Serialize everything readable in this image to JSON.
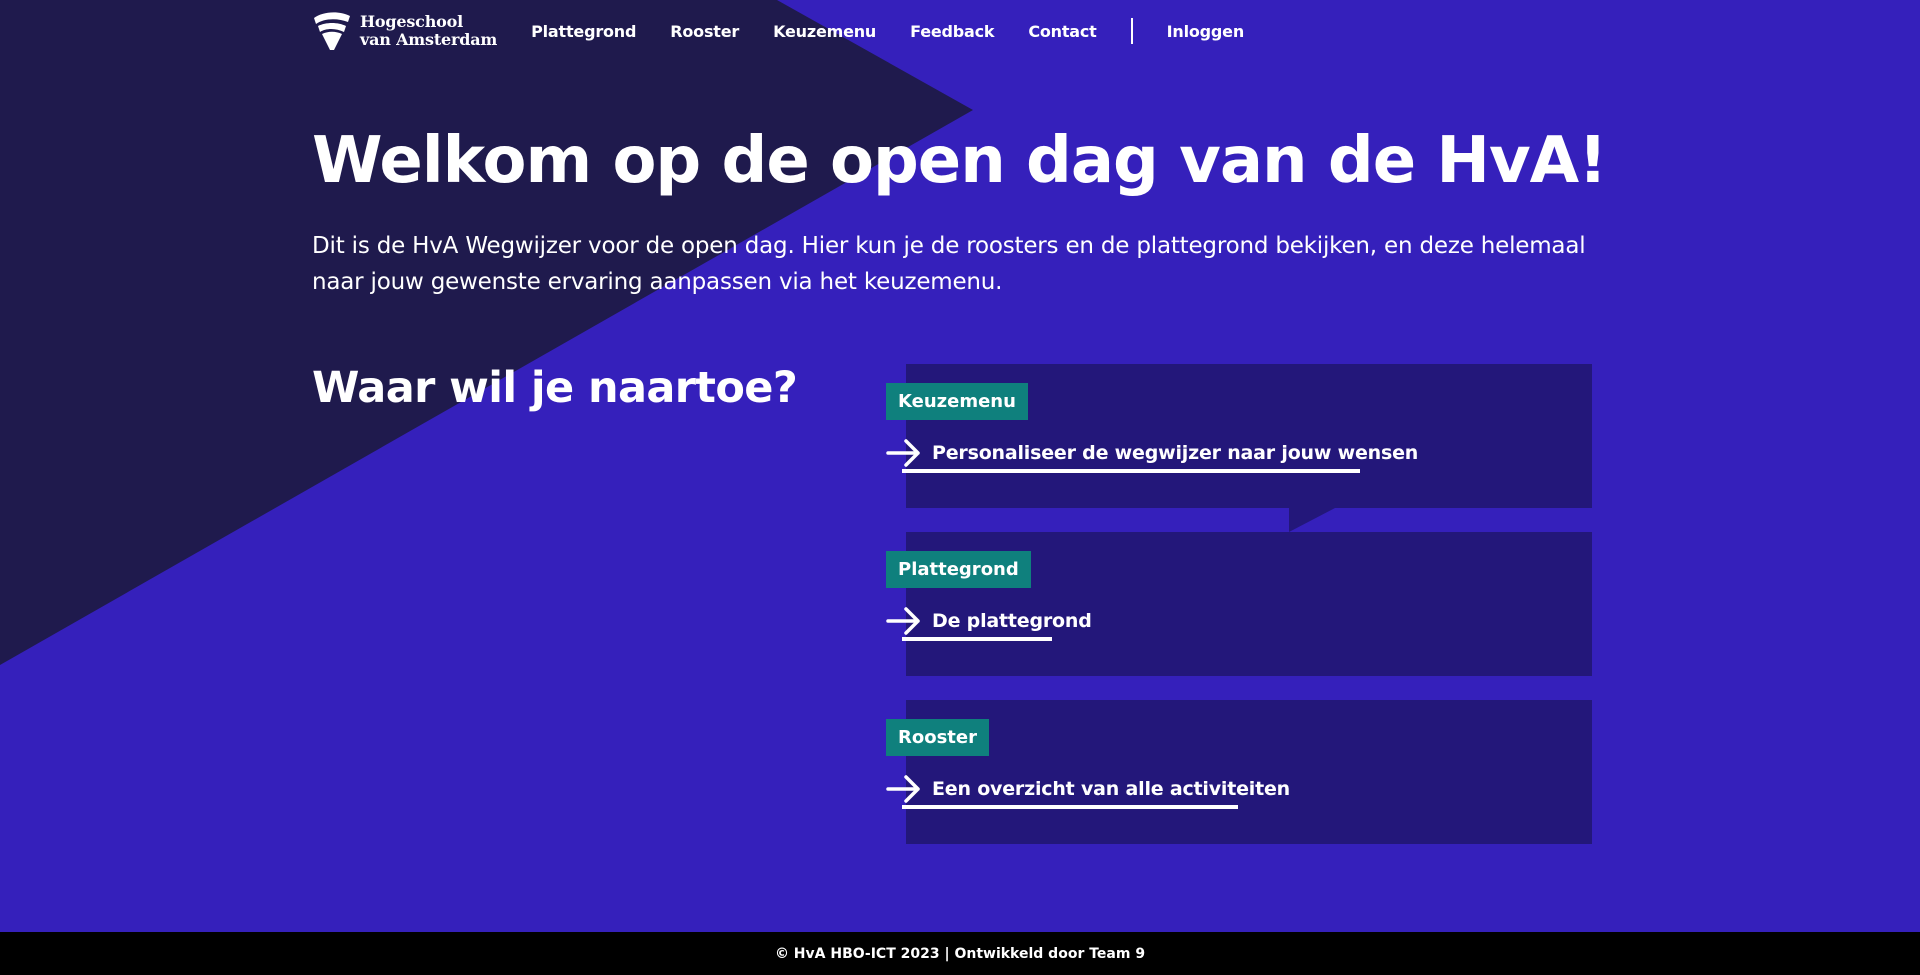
{
  "brand": {
    "name": "Hogeschool\nvan Amsterdam",
    "logo_icon": "hva-shield-logo"
  },
  "nav": {
    "items": [
      {
        "label": "Plattegrond"
      },
      {
        "label": "Rooster"
      },
      {
        "label": "Keuzemenu"
      },
      {
        "label": "Feedback"
      },
      {
        "label": "Contact"
      }
    ],
    "login_label": "Inloggen"
  },
  "hero": {
    "title": "Welkom op de open dag van de HvA!",
    "text": "Dit is de HvA Wegwijzer voor de open dag. Hier kun je de roosters en de plattegrond bekijken, en deze helemaal naar jouw gewenste ervaring aanpassen via het keuzemenu."
  },
  "section": {
    "title": "Waar wil je naartoe?"
  },
  "cards": [
    {
      "tag": "Keuzemenu",
      "link": "Personaliseer de wegwijzer naar jouw wensen",
      "icon": "arrow-right-icon"
    },
    {
      "tag": "Plattegrond",
      "link": "De plattegrond",
      "icon": "arrow-right-icon"
    },
    {
      "tag": "Rooster",
      "link": "Een overzicht van alle activiteiten",
      "icon": "arrow-right-icon"
    }
  ],
  "footer": {
    "text": "© HvA HBO-ICT 2023 | Ontwikkeld door Team 9"
  },
  "colors": {
    "background": "#3520bb",
    "triangle": "#1f1a4d",
    "card": "#23177a",
    "tag": "#0f807d",
    "footer": "#000000",
    "text": "#ffffff"
  }
}
